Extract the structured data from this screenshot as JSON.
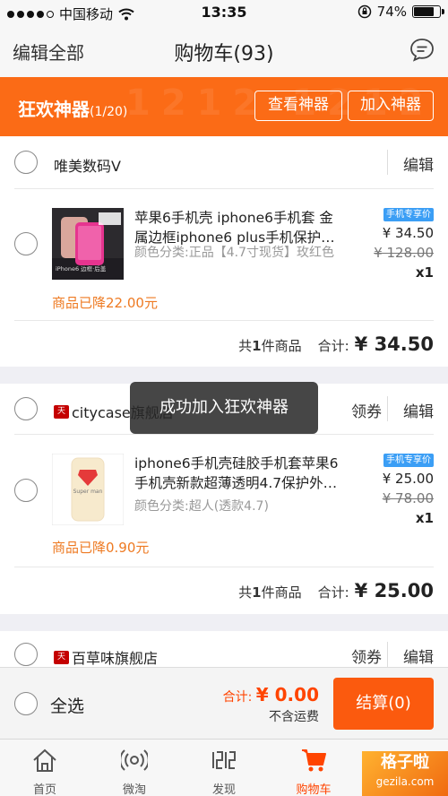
{
  "status_bar": {
    "carrier": "中国移动",
    "time": "13:35",
    "battery": "74%",
    "battery_level": 0.74
  },
  "nav": {
    "edit_all": "编辑全部",
    "title": "购物车(93)"
  },
  "banner": {
    "name": "狂欢神器",
    "count": "(1/20)",
    "bg_text": "1212 1212",
    "view_button": "查看神器",
    "add_button": "加入神器"
  },
  "shops": [
    {
      "name": "唯美数码V",
      "edit": "编辑",
      "item": {
        "title": "苹果6手机壳 iphone6手机套 金属边框iphone6 plus手机保护…",
        "spec": "颜色分类:正品【4.7寸现货】玫红色",
        "badge": "手机专享价",
        "price": "¥ 34.50",
        "original_price": "¥ 128.00",
        "qty": "x1",
        "drop": "商品已降22.00元",
        "thumb_text": "iPhone6 边框·后盖"
      },
      "count_prefix": "共",
      "count_num": "1",
      "count_suffix": "件商品",
      "total_label": "合计:",
      "total": "¥ 34.50"
    },
    {
      "name": "citycase旗舰店",
      "tmall_badge": "天猫",
      "coupon": "领券",
      "edit": "编辑",
      "item": {
        "title": "iphone6手机壳硅胶手机套苹果6手机壳新款超薄透明4.7保护外…",
        "spec": "颜色分类:超人(透款4.7)",
        "badge": "手机专享价",
        "price": "¥ 25.00",
        "original_price": "¥ 78.00",
        "qty": "x1",
        "drop": "商品已降0.90元",
        "thumb_text": "Super man"
      },
      "count_prefix": "共",
      "count_num": "1",
      "count_suffix": "件商品",
      "total_label": "合计:",
      "total": "¥ 25.00"
    },
    {
      "name": "百草味旗舰店",
      "tmall_badge": "天猫",
      "coupon": "领券",
      "edit": "编辑"
    }
  ],
  "toast": "成功加入狂欢神器",
  "bottom_bar": {
    "select_all": "全选",
    "total_label": "合计:",
    "total": "¥ 0.00",
    "shipping_note": "不含运费",
    "checkout": "结算(0)"
  },
  "tabs": [
    {
      "label": "首页",
      "icon": "home-icon"
    },
    {
      "label": "微淘",
      "icon": "broadcast-icon"
    },
    {
      "label": "发现",
      "icon": "1212-icon"
    },
    {
      "label": "购物车",
      "icon": "cart-icon",
      "active": true
    }
  ],
  "watermark": {
    "line1": "格子啦",
    "line2": "gezila.com"
  },
  "colors": {
    "accent": "#fb6b16",
    "checkout": "#fb5a0e",
    "price_drop": "#ee7a22",
    "badge": "#3b9ef5",
    "tmall": "#c40000"
  }
}
